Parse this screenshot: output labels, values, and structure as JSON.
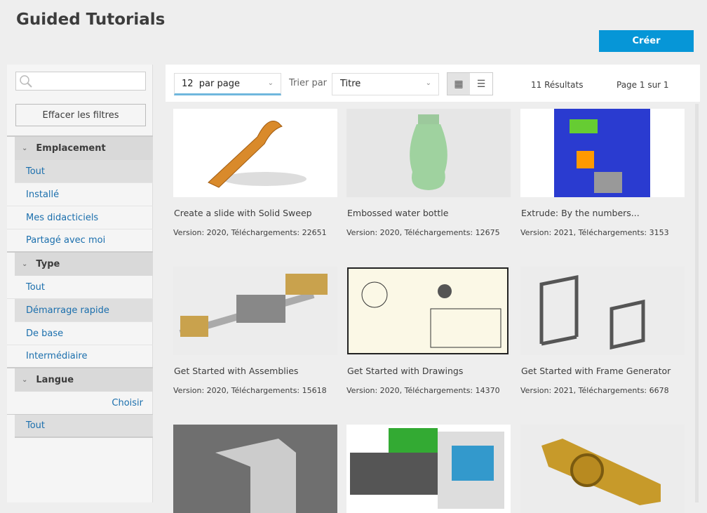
{
  "header": {
    "title": "Guided Tutorials",
    "create_label": "Créer"
  },
  "sidebar": {
    "search_placeholder": "",
    "clear_label": "Effacer les filtres",
    "groups": [
      {
        "label": "Emplacement",
        "items": [
          "Tout",
          "Installé",
          "Mes didacticiels",
          "Partagé avec moi"
        ],
        "selected": "Tout"
      },
      {
        "label": "Type",
        "items": [
          "Tout",
          "Démarrage rapide",
          "De base",
          "Intermédiaire"
        ],
        "selected": "Démarrage rapide"
      },
      {
        "label": "Langue",
        "choose_label": "Choisir",
        "items": [
          "Tout"
        ],
        "selected": "Tout"
      }
    ]
  },
  "toolbar": {
    "per_page": "12  par page",
    "sort_label": "Trier par",
    "sort_value": "Titre",
    "view": "grid",
    "results": "11 Résultats",
    "page": "Page 1 sur 1"
  },
  "cards": [
    {
      "title": "Create a slide with Solid Sweep",
      "meta": "Version: 2020, Téléchargements: 22651"
    },
    {
      "title": "Embossed water bottle",
      "meta": "Version: 2020, Téléchargements: 12675"
    },
    {
      "title": "Extrude: By the numbers...",
      "meta": "Version: 2021, Téléchargements: 3153"
    },
    {
      "title": "Get Started with Assemblies",
      "meta": "Version: 2020, Téléchargements: 15618"
    },
    {
      "title": "Get Started with Drawings",
      "meta": "Version: 2020, Téléchargements: 14370"
    },
    {
      "title": "Get Started with Frame Generator",
      "meta": "Version: 2021, Téléchargements: 6678"
    },
    {
      "title": "",
      "meta": ""
    },
    {
      "title": "",
      "meta": ""
    },
    {
      "title": "",
      "meta": ""
    }
  ],
  "colors": {
    "accent": "#0696d7",
    "link": "#1b6fad"
  }
}
